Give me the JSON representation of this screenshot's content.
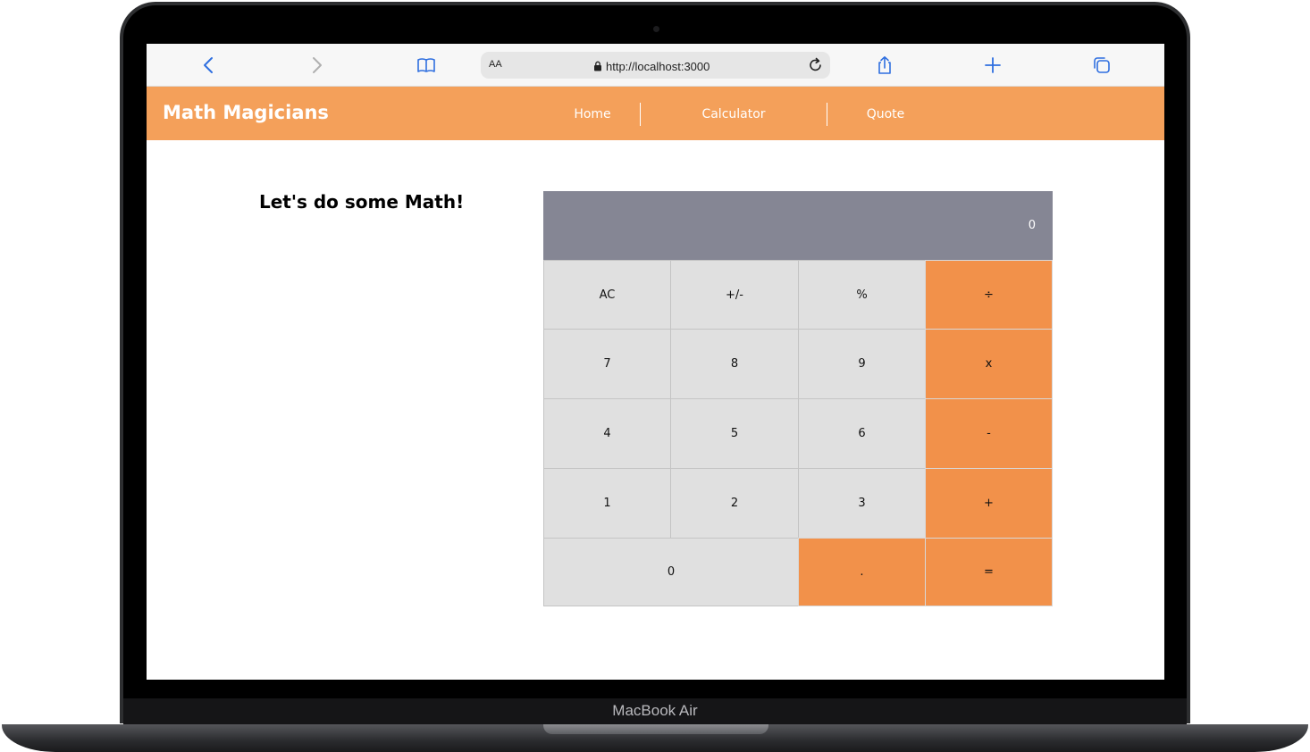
{
  "device": {
    "label": "MacBook Air"
  },
  "browser": {
    "text_size_label": "AA",
    "url": "http://localhost:3000",
    "icons": {
      "back": "chevron-left-icon",
      "forward": "chevron-right-icon",
      "bookmarks": "book-icon",
      "lock": "lock-icon",
      "reload": "reload-icon",
      "share": "share-icon",
      "new_tab": "plus-icon",
      "tabs": "tabs-icon"
    }
  },
  "app": {
    "title": "Math Magicians",
    "nav": [
      "Home",
      "Calculator",
      "Quote"
    ],
    "accent_color": "#f4a05a"
  },
  "page": {
    "heading": "Let's do some Math!"
  },
  "calculator": {
    "display": "0",
    "keys": [
      "AC",
      "+/-",
      "%",
      "÷",
      "7",
      "8",
      "9",
      "x",
      "4",
      "5",
      "6",
      "-",
      "1",
      "2",
      "3",
      "+",
      "0",
      ".",
      "="
    ],
    "operator_color": "#f2914a",
    "key_color": "#e0e0e0",
    "display_color": "#858694"
  }
}
